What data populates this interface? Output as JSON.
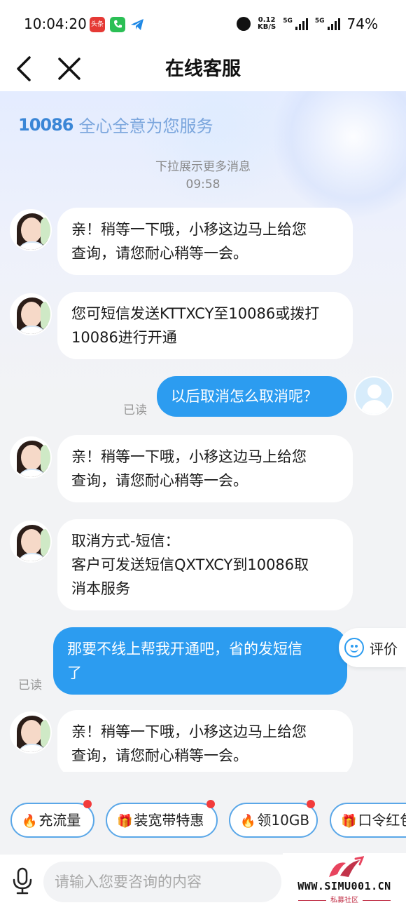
{
  "status_bar": {
    "time": "10:04:20",
    "apps": [
      "头条"
    ],
    "net_speed_value": "0.12",
    "net_speed_unit": "KB/S",
    "signal1_label": "5G",
    "signal2_label": "5G",
    "battery": "74%"
  },
  "nav": {
    "title": "在线客服"
  },
  "hero": {
    "logo": "10086",
    "slogan": "全心全意为您服务"
  },
  "chat": {
    "pull_hint": "下拉展示更多消息",
    "timestamp": "09:58",
    "messages": [
      {
        "from": "bot",
        "lines": [
          "亲！稍等一下哦，小移这边马上给您",
          "查询，请您耐心稍等一会。"
        ]
      },
      {
        "from": "bot",
        "lines": [
          "您可短信发送KTTXCY至10086或拨打",
          "10086进行开通"
        ]
      },
      {
        "from": "user",
        "lines": [
          "以后取消怎么取消呢？"
        ],
        "status": "已读"
      },
      {
        "from": "bot",
        "lines": [
          "亲！稍等一下哦，小移这边马上给您",
          "查询，请您耐心稍等一会。"
        ]
      },
      {
        "from": "bot",
        "lines": [
          "取消方式-短信：",
          "客户可发送短信QXTXCY到10086取",
          "消本服务"
        ]
      },
      {
        "from": "user",
        "lines": [
          "那要不线上帮我开通吧，省的发短信",
          "了"
        ],
        "status": "已读"
      },
      {
        "from": "bot",
        "lines": [
          "亲！稍等一下哦，小移这边马上给您",
          "查询，请您耐心稍等一会。"
        ]
      }
    ]
  },
  "rate": {
    "label": "评价"
  },
  "quick_chips": [
    {
      "emoji": "🔥",
      "label": "充流量"
    },
    {
      "emoji": "🎁",
      "label": "装宽带特惠"
    },
    {
      "emoji": "🔥",
      "label": "领10GB"
    },
    {
      "emoji": "🎁",
      "label": "口令红包"
    }
  ],
  "input": {
    "placeholder": "请输入您要咨询的内容"
  },
  "watermark": {
    "domain": "WWW.SIMU001.CN",
    "sub": "私募社区"
  },
  "colors": {
    "accent_blue": "#2c9cf0",
    "chip_border": "#5aa7e8",
    "dot_red": "#f23b3b",
    "bg": "#f2f3f5"
  }
}
